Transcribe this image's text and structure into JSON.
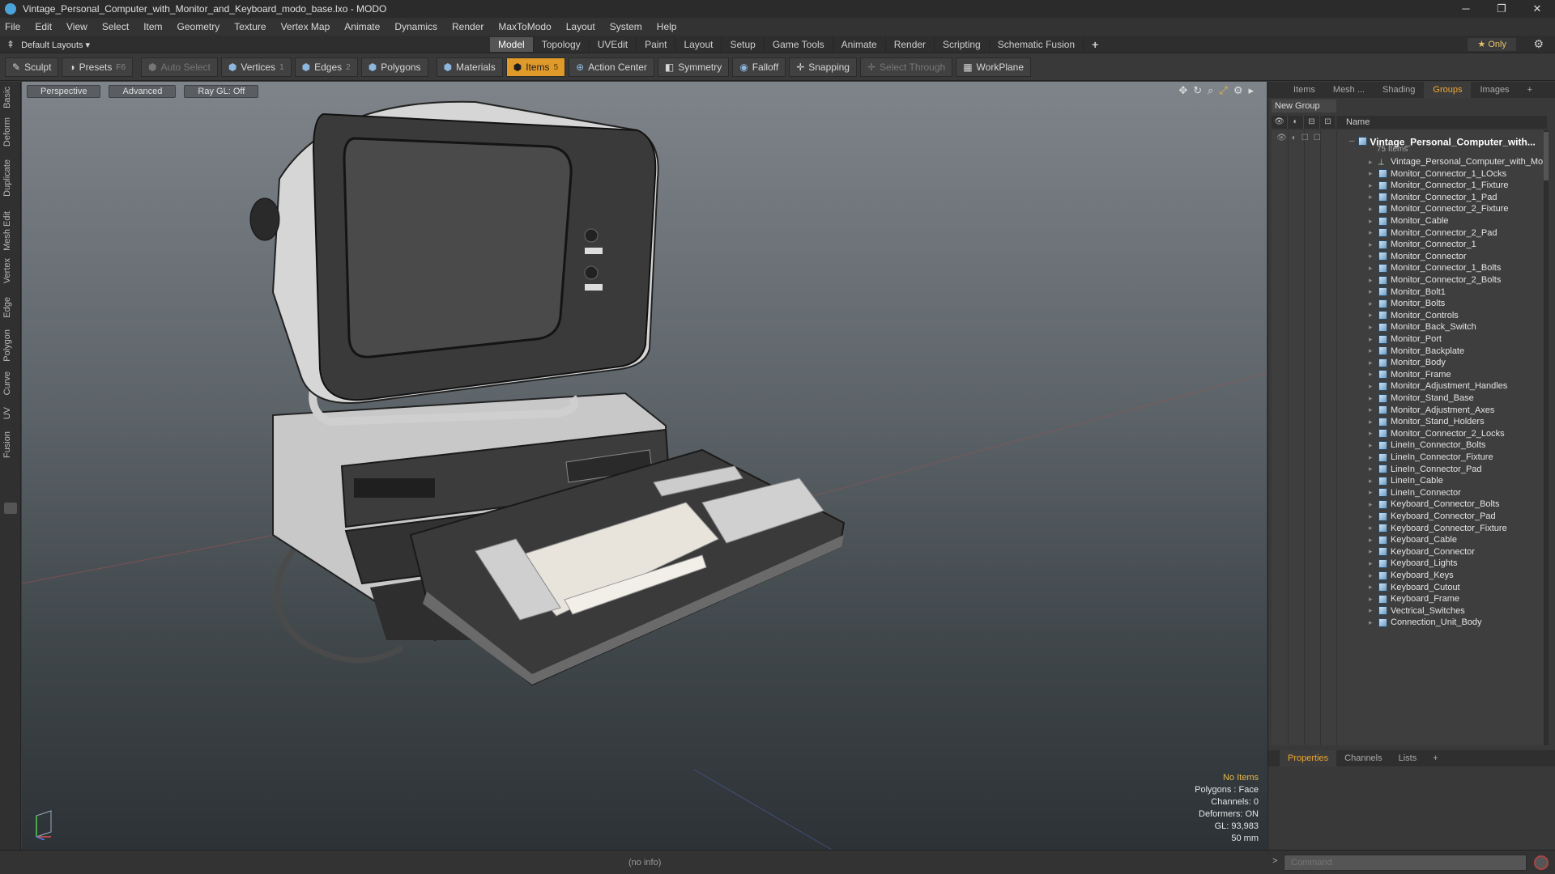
{
  "window": {
    "title": "Vintage_Personal_Computer_with_Monitor_and_Keyboard_modo_base.lxo - MODO",
    "minimize": "─",
    "maximize": "❐",
    "close": "✕"
  },
  "menu": [
    "File",
    "Edit",
    "View",
    "Select",
    "Item",
    "Geometry",
    "Texture",
    "Vertex Map",
    "Animate",
    "Dynamics",
    "Render",
    "MaxToModo",
    "Layout",
    "System",
    "Help"
  ],
  "layouts": {
    "label": "Default Layouts ▾"
  },
  "mode_tabs": [
    "Model",
    "Topology",
    "UVEdit",
    "Paint",
    "Layout",
    "Setup",
    "Game Tools",
    "Animate",
    "Render",
    "Scripting",
    "Schematic Fusion",
    "+"
  ],
  "active_mode_tab": "Model",
  "only_label": "Only",
  "toolbar": {
    "sculpt": "Sculpt",
    "presets": "Presets",
    "presets_key": "F6",
    "auto_select": "Auto Select",
    "vertices": "Vertices",
    "vertices_key": "1",
    "edges": "Edges",
    "edges_key": "2",
    "polygons": "Polygons",
    "materials": "Materials",
    "items": "Items",
    "items_key": "5",
    "action_center": "Action Center",
    "symmetry": "Symmetry",
    "falloff": "Falloff",
    "snapping": "Snapping",
    "select_through": "Select Through",
    "workplane": "WorkPlane"
  },
  "left_tabs": [
    "Basic",
    "Deform",
    "Duplicate",
    "Mesh Edit",
    "Vertex",
    "Edge",
    "Polygon",
    "Curve",
    "UV",
    "Fusion"
  ],
  "viewport": {
    "view": "Perspective",
    "style": "Advanced",
    "raygl": "Ray GL: Off",
    "stats": {
      "selection": "No Items",
      "polygons": "Polygons : Face",
      "channels": "Channels: 0",
      "deformers": "Deformers: ON",
      "gl": "GL: 93,983",
      "focal": "50 mm"
    }
  },
  "right_tabs": [
    "Items",
    "Mesh ...",
    "Shading",
    "Groups",
    "Images",
    "+"
  ],
  "active_right_tab": "Groups",
  "groups": {
    "new_group": "New Group",
    "name_header": "Name",
    "root_name": "Vintage_Personal_Computer_with...",
    "root_count": "75 Items",
    "items": [
      "Vintage_Personal_Computer_with_Mo...",
      "Monitor_Connector_1_LOcks",
      "Monitor_Connector_1_Fixture",
      "Monitor_Connector_1_Pad",
      "Monitor_Connector_2_Fixture",
      "Monitor_Cable",
      "Monitor_Connector_2_Pad",
      "Monitor_Connector_1",
      "Monitor_Connector",
      "Monitor_Connector_1_Bolts",
      "Monitor_Connector_2_Bolts",
      "Monitor_Bolt1",
      "Monitor_Bolts",
      "Monitor_Controls",
      "Monitor_Back_Switch",
      "Monitor_Port",
      "Monitor_Backplate",
      "Monitor_Body",
      "Monitor_Frame",
      "Monitor_Adjustment_Handles",
      "Monitor_Stand_Base",
      "Monitor_Adjustment_Axes",
      "Monitor_Stand_Holders",
      "Monitor_Connector_2_Locks",
      "LineIn_Connector_Bolts",
      "LineIn_Connector_Fixture",
      "LineIn_Connector_Pad",
      "LineIn_Cable",
      "LineIn_Connector",
      "Keyboard_Connector_Bolts",
      "Keyboard_Connector_Pad",
      "Keyboard_Connector_Fixture",
      "Keyboard_Cable",
      "Keyboard_Connector",
      "Keyboard_Lights",
      "Keyboard_Keys",
      "Keyboard_Cutout",
      "Keyboard_Frame",
      "Vectrical_Switches",
      "Connection_Unit_Body"
    ]
  },
  "prop_tabs": [
    "Properties",
    "Channels",
    "Lists",
    "+"
  ],
  "active_prop_tab": "Properties",
  "command_placeholder": "Command",
  "status_text": "(no info)",
  "colors": {
    "accent": "#e09a2a",
    "active_tab_text": "#f0a830",
    "selection_text": "#e8b84a"
  }
}
